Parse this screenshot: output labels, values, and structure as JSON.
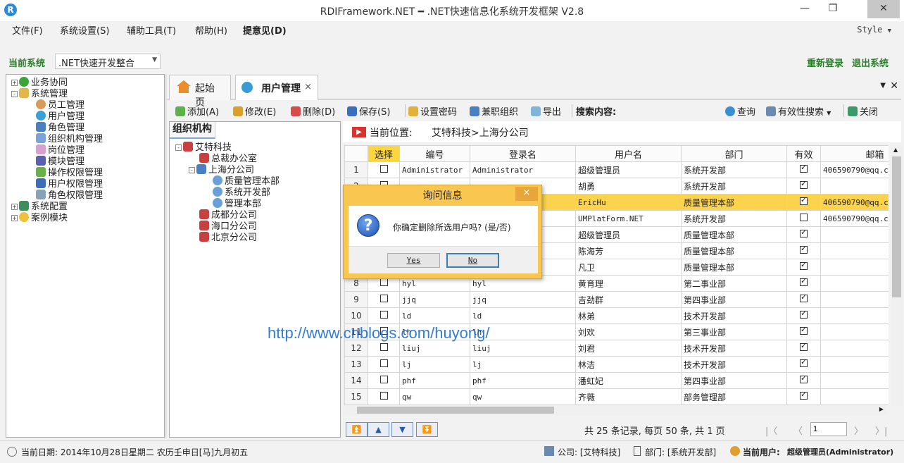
{
  "window": {
    "title": "RDIFramework.NET ━ .NET快速信息化系统开发框架 V2.8",
    "logo": "R"
  },
  "menu": {
    "items": [
      "文件(F)",
      "系统设置(S)",
      "辅助工具(T)",
      "帮助(H)",
      "提意见(D)"
    ],
    "style_label": "Style"
  },
  "system": {
    "label": "当前系统",
    "selected": ".NET快速开发整合",
    "relogin": "重新登录",
    "logout": "退出系统"
  },
  "nav_tree": [
    {
      "label": "业务协同",
      "level": 0,
      "toggle": "+",
      "icon": "business-icon"
    },
    {
      "label": "系统管理",
      "level": 0,
      "toggle": "-",
      "icon": "system-folder-icon"
    },
    {
      "label": "员工管理",
      "level": 1,
      "icon": "staff-icon"
    },
    {
      "label": "用户管理",
      "level": 1,
      "icon": "user-icon"
    },
    {
      "label": "角色管理",
      "level": 1,
      "icon": "role-icon"
    },
    {
      "label": "组织机构管理",
      "level": 1,
      "icon": "org-icon"
    },
    {
      "label": "岗位管理",
      "level": 1,
      "icon": "post-icon"
    },
    {
      "label": "模块管理",
      "level": 1,
      "icon": "module-icon"
    },
    {
      "label": "操作权限管理",
      "level": 1,
      "icon": "operation-icon"
    },
    {
      "label": "用户权限管理",
      "level": 1,
      "icon": "user-permission-icon"
    },
    {
      "label": "角色权限管理",
      "level": 1,
      "icon": "role-permission-icon"
    },
    {
      "label": "系统配置",
      "level": 0,
      "toggle": "+",
      "icon": "config-icon"
    },
    {
      "label": "案例模块",
      "level": 0,
      "toggle": "+",
      "icon": "case-icon"
    }
  ],
  "tabs": [
    {
      "label": "起始页",
      "icon": "home-icon"
    },
    {
      "label": "用户管理",
      "icon": "user-icon",
      "close": "×"
    }
  ],
  "toolbar": {
    "add": "添加(A)",
    "edit": "修改(E)",
    "delete": "删除(D)",
    "save": "保存(S)",
    "set_password": "设置密码",
    "part_time_org": "兼职组织",
    "export": "导出",
    "search_label": "搜索内容:",
    "query": "查询",
    "valid_search": "有效性搜索",
    "close": "关闭"
  },
  "org_panel": {
    "title": "组织机构",
    "tree": [
      {
        "label": "艾特科技",
        "level": 0,
        "toggle": "-"
      },
      {
        "label": "总裁办公室",
        "level": 1
      },
      {
        "label": "上海分公司",
        "level": 1,
        "toggle": "-"
      },
      {
        "label": "质量管理本部",
        "level": 2
      },
      {
        "label": "系统开发部",
        "level": 2
      },
      {
        "label": "管理本部",
        "level": 2
      },
      {
        "label": "成都分公司",
        "level": 1
      },
      {
        "label": "海口分公司",
        "level": 1
      },
      {
        "label": "北京分公司",
        "level": 1
      }
    ]
  },
  "location": {
    "label": "当前位置:",
    "path": "艾特科技>上海分公司"
  },
  "grid": {
    "columns": [
      "选择",
      "编号",
      "登录名",
      "用户名",
      "部门",
      "有效",
      "邮箱"
    ],
    "rows": [
      {
        "n": "1",
        "code": "Administrator",
        "login": "Administrator",
        "name": "超级管理员",
        "dept": "系统开发部",
        "valid": true,
        "email": "406590790@qq.c"
      },
      {
        "n": "2",
        "code": "",
        "login": "",
        "name": "胡勇",
        "dept": "系统开发部",
        "valid": true,
        "email": ""
      },
      {
        "n": "3",
        "code": "",
        "login": "",
        "name": "EricHu",
        "dept": "质量管理本部",
        "valid": true,
        "email": "406590790@qq.c",
        "highlight": true
      },
      {
        "n": "4",
        "code": "",
        "login": "",
        "name": "UMPlatForm.NET",
        "dept": "系统开发部",
        "valid": false,
        "email": "406590790@qq.c"
      },
      {
        "n": "5",
        "code": "",
        "login": "",
        "name": "超级管理员",
        "dept": "质量管理本部",
        "valid": true,
        "email": ""
      },
      {
        "n": "6",
        "code": "",
        "login": "",
        "name": "陈海芳",
        "dept": "质量管理本部",
        "valid": true,
        "email": ""
      },
      {
        "n": "7",
        "code": "",
        "login": "",
        "name": "凡卫",
        "dept": "质量管理本部",
        "valid": true,
        "email": ""
      },
      {
        "n": "8",
        "code": "hyl",
        "login": "hyl",
        "name": "黄育理",
        "dept": "第二事业部",
        "valid": true,
        "email": ""
      },
      {
        "n": "9",
        "code": "jjq",
        "login": "jjq",
        "name": "吉劲群",
        "dept": "第四事业部",
        "valid": true,
        "email": ""
      },
      {
        "n": "10",
        "code": "ld",
        "login": "ld",
        "name": "林弟",
        "dept": "技术开发部",
        "valid": true,
        "email": ""
      },
      {
        "n": "11",
        "code": "lh",
        "login": "lh",
        "name": "刘欢",
        "dept": "第三事业部",
        "valid": true,
        "email": ""
      },
      {
        "n": "12",
        "code": "liuj",
        "login": "liuj",
        "name": "刘君",
        "dept": "技术开发部",
        "valid": true,
        "email": ""
      },
      {
        "n": "13",
        "code": "lj",
        "login": "lj",
        "name": "林洁",
        "dept": "技术开发部",
        "valid": true,
        "email": ""
      },
      {
        "n": "14",
        "code": "phf",
        "login": "phf",
        "name": "潘虹妃",
        "dept": "第四事业部",
        "valid": true,
        "email": ""
      },
      {
        "n": "15",
        "code": "qw",
        "login": "qw",
        "name": "齐薇",
        "dept": "部务管理部",
        "valid": true,
        "email": ""
      }
    ]
  },
  "dialog": {
    "title": "询问信息",
    "close": "×",
    "message": "你确定删除所选用户吗? (是/否)",
    "yes": "Yes",
    "no": "No",
    "icon": "?"
  },
  "pager": {
    "summary": "共 25 条记录, 每页 50 条, 共 1 页",
    "page_value": "1",
    "first": "|〈",
    "prev": "〈",
    "next": "〉",
    "last": "〉|"
  },
  "status": {
    "date": "当前日期: 2014年10月28日星期二 农历壬申日[马]九月初五",
    "company": "公司: [艾特科技]",
    "dept": "部门: [系统开发部]",
    "user_label": "当前用户:",
    "user": "超级管理员(Administrator)"
  },
  "watermark": "http://www.cnblogs.com/huyong/"
}
